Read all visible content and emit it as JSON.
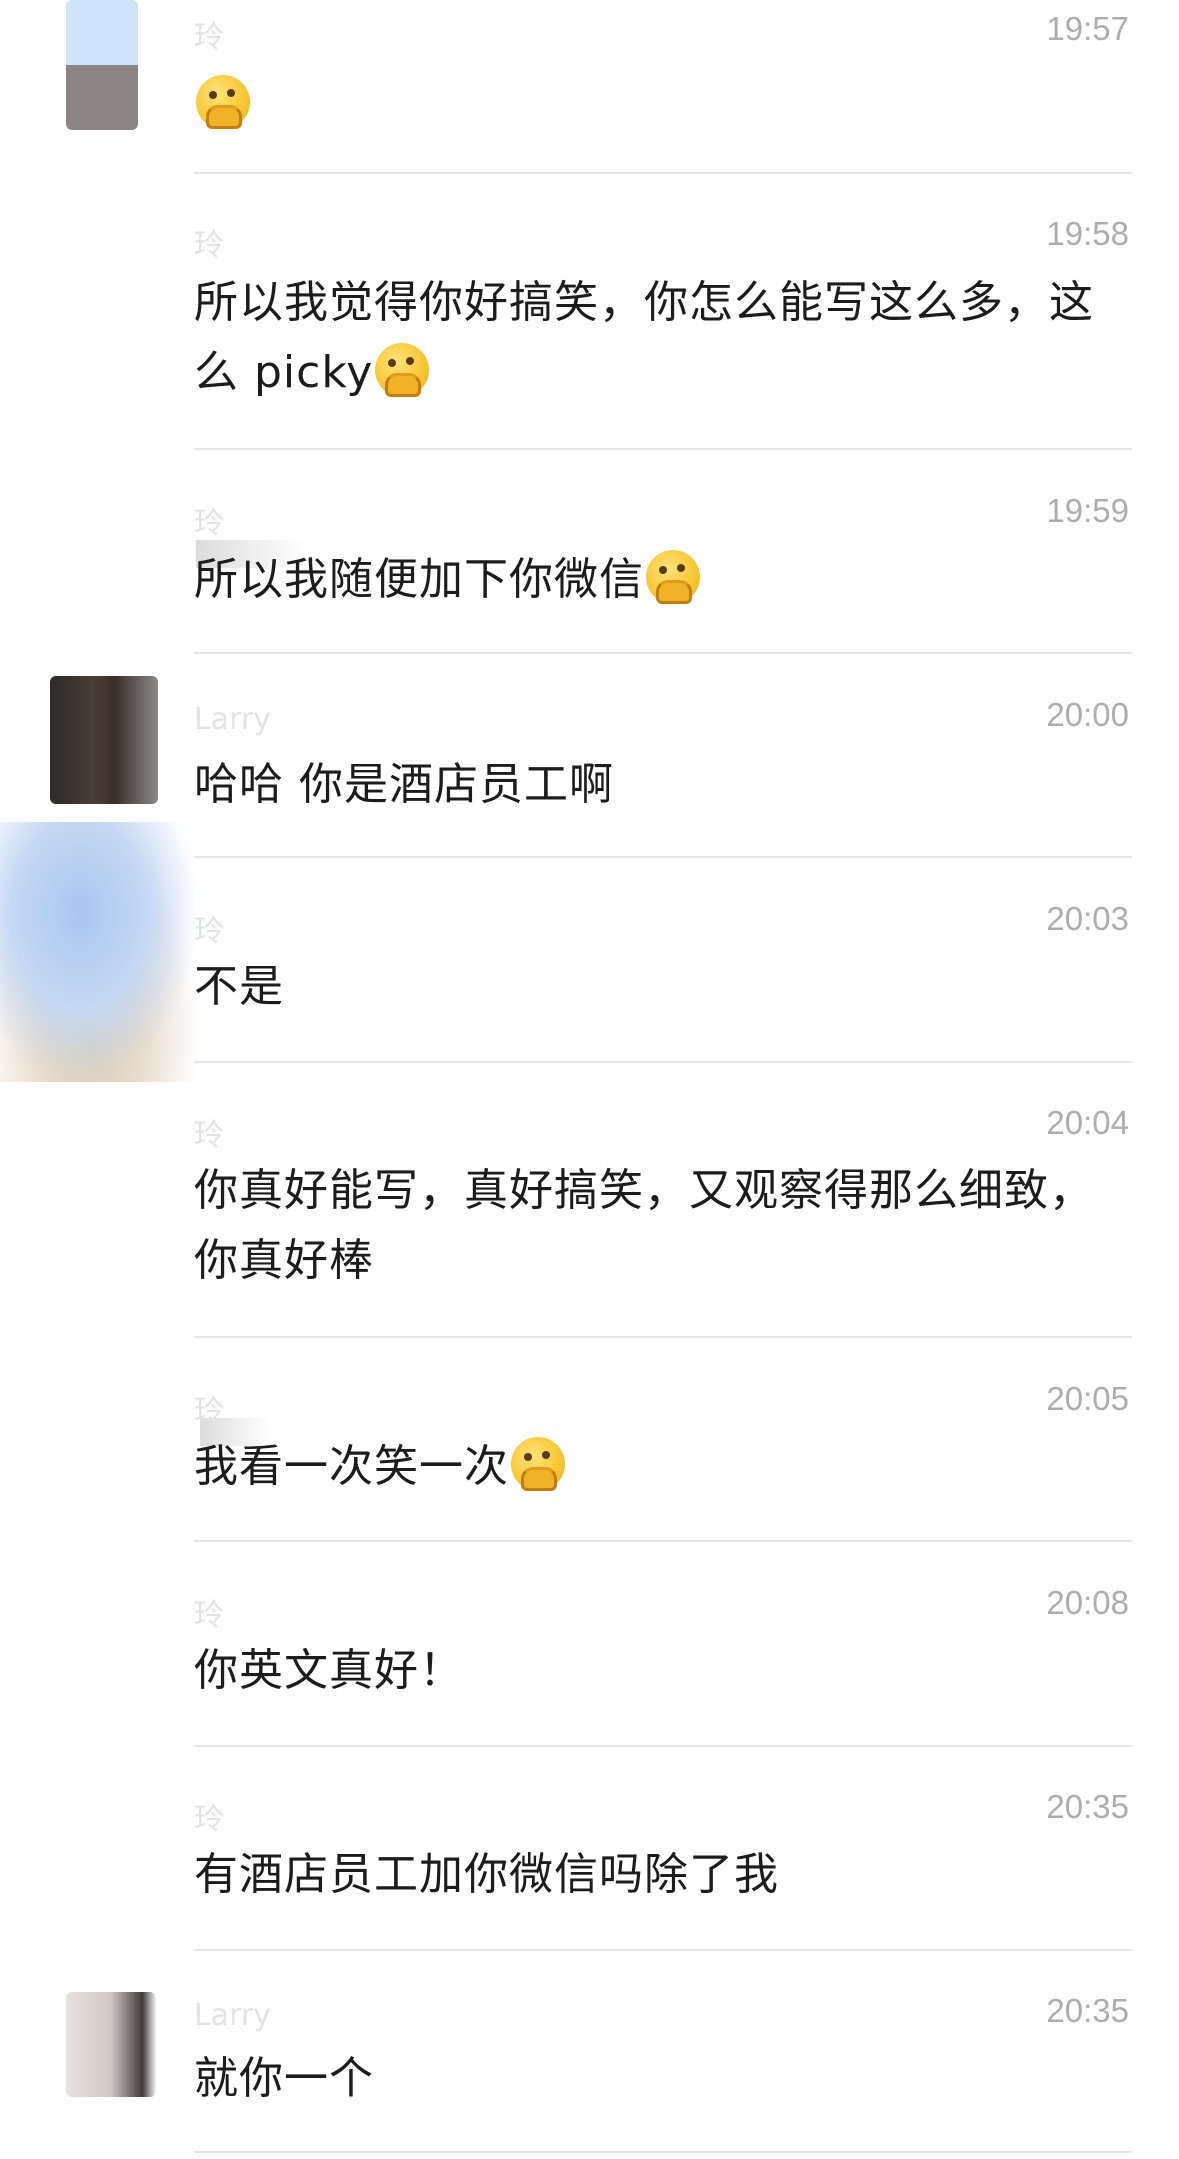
{
  "messages": [
    {
      "sender": "玲",
      "time": "19:57",
      "text": "",
      "emoji": "thinking-face"
    },
    {
      "sender": "玲",
      "time": "19:58",
      "text": "所以我觉得你好搞笑，你怎么能写这么多，这么 picky",
      "emoji": "thinking-face"
    },
    {
      "sender": "玲",
      "time": "19:59",
      "text": "所以我随便加下你微信",
      "emoji": "thinking-face"
    },
    {
      "sender": "Larry",
      "time": "20:00",
      "text": "哈哈 你是酒店员工啊",
      "emoji": ""
    },
    {
      "sender": "玲",
      "time": "20:03",
      "text": "不是",
      "emoji": ""
    },
    {
      "sender": "玲",
      "time": "20:04",
      "text": "你真好能写，真好搞笑，又观察得那么细致，你真好棒",
      "emoji": ""
    },
    {
      "sender": "玲",
      "time": "20:05",
      "text": "我看一次笑一次",
      "emoji": "thinking-face"
    },
    {
      "sender": "玲",
      "time": "20:08",
      "text": "你英文真好！",
      "emoji": ""
    },
    {
      "sender": "玲",
      "time": "20:35",
      "text": "有酒店员工加你微信吗除了我",
      "emoji": ""
    },
    {
      "sender": "Larry",
      "time": "20:35",
      "text": "就你一个",
      "emoji": ""
    }
  ]
}
